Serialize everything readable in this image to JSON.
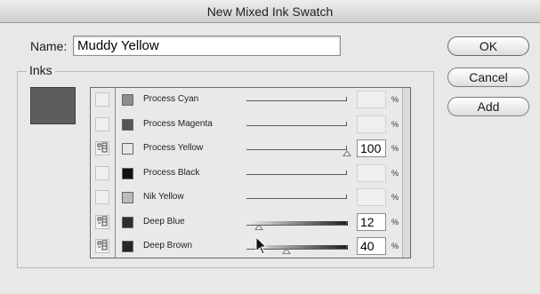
{
  "window": {
    "title": "New Mixed Ink Swatch"
  },
  "name": {
    "label": "Name:",
    "value": "Muddy Yellow"
  },
  "buttons": {
    "ok": "OK",
    "cancel": "Cancel",
    "add": "Add"
  },
  "inks": {
    "label": "Inks",
    "preview_color": "#5d5d5d",
    "rows": [
      {
        "name": "Process Cyan",
        "color": "#8e8e8e",
        "included": false,
        "percent": "",
        "level": 0
      },
      {
        "name": "Process Magenta",
        "color": "#555555",
        "included": false,
        "percent": "",
        "level": 0
      },
      {
        "name": "Process Yellow",
        "color": "#e6e6e6",
        "included": true,
        "percent": "100",
        "level": 100
      },
      {
        "name": "Process Black",
        "color": "#111111",
        "included": false,
        "percent": "",
        "level": 0
      },
      {
        "name": "Nik Yellow",
        "color": "#bcbcbc",
        "included": false,
        "percent": "",
        "level": 0
      },
      {
        "name": "Deep Blue",
        "color": "#2e2e2e",
        "included": true,
        "percent": "12",
        "level": 12
      },
      {
        "name": "Deep Brown",
        "color": "#262626",
        "included": true,
        "percent": "40",
        "level": 40
      }
    ],
    "percent_sign": "%",
    "include_icon": "mixed-ink-include-icon"
  }
}
